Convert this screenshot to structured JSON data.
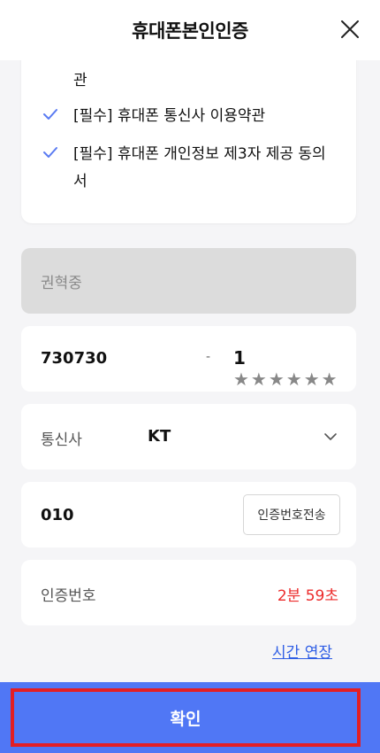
{
  "header": {
    "title": "휴대폰본인인증",
    "close_icon": "close-icon"
  },
  "terms": {
    "fragment": "관",
    "items": [
      {
        "text": "[필수] 휴대폰 통신사 이용약관"
      },
      {
        "text": "[필수] 휴대폰 개인정보 제3자 제공 동의서"
      }
    ],
    "check_color": "#5a7bf2"
  },
  "form": {
    "name_value": "권혁중",
    "rrn_front": "730730",
    "rrn_dash": "-",
    "rrn_back_first": "1",
    "rrn_back_mask": "★★★★★★",
    "carrier_label": "통신사",
    "carrier_value": "KT",
    "phone_value": "010",
    "send_code_button": "인증번호전송",
    "code_label": "인증번호",
    "timer": "2분 59초",
    "extend_link": "시간 연장"
  },
  "confirm_button": "확인",
  "colors": {
    "primary": "#5077f5",
    "highlight_border": "#e31e24",
    "timer": "#ec2b2b",
    "link": "#2f5ee5"
  }
}
